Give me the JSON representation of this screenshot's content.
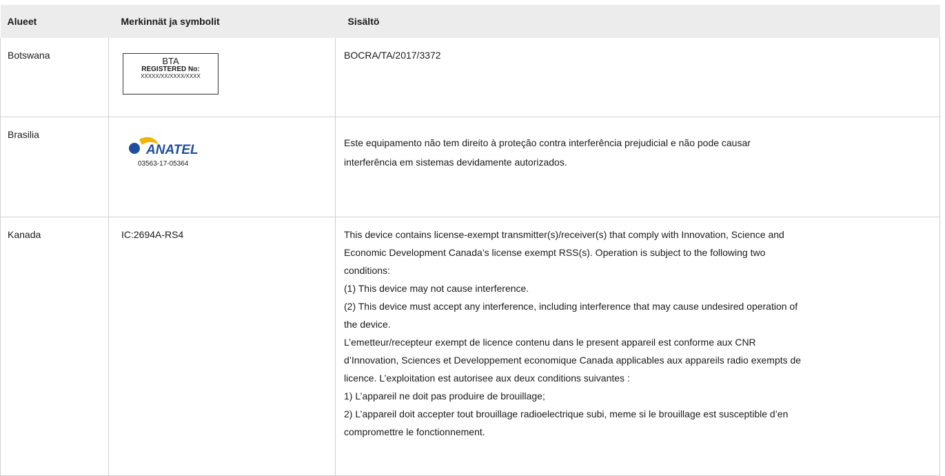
{
  "table": {
    "headers": [
      "Alueet",
      "Merkinnät ja symbolit",
      "Sisältö"
    ],
    "rows": [
      {
        "region": "Botswana",
        "mark": {
          "line1": "BTA",
          "line2": "REGISTERED No:",
          "line3": "XXXXX/XX/XXXX/XXXX"
        },
        "content_lines": [
          "BOCRA/TA/2017/3372"
        ]
      },
      {
        "region": "Brasilia",
        "mark": {
          "logo_text": "ANATEL",
          "code": "03563-17-05364"
        },
        "content_lines": [
          "Este equipamento não tem direito à proteção contra interferência prejudicial e não pode causar",
          "interferência em sistemas devidamente autorizados."
        ]
      },
      {
        "region": "Kanada",
        "mark": {
          "text": "IC:2694A-RS4"
        },
        "content_lines": [
          "This device contains license-exempt transmitter(s)/receiver(s) that comply with Innovation, Science and",
          "Economic Development Canada’s license exempt RSS(s). Operation is subject to the following two",
          "conditions:",
          "(1) This device may not cause interference.",
          "(2) This device must accept any interference, including interference that may cause undesired operation of",
          "the device.",
          "L’emetteur/recepteur exempt de licence contenu dans le present appareil est conforme aux CNR",
          "d’Innovation, Sciences et Developpement economique Canada applicables aux appareils radio exempts de",
          "licence. L’exploitation est autorisee aux deux conditions suivantes :",
          "1) L’appareil ne doit pas produire de brouillage;",
          "2) L’appareil doit accepter tout brouillage radioelectrique subi, meme si le brouillage est susceptible d’en",
          "compromettre le fonctionnement."
        ]
      }
    ]
  },
  "colors": {
    "header_bg": "#ececec",
    "border": "#d0d0d0",
    "anatel_blue": "#1f4e9c",
    "anatel_yellow": "#f2b300"
  }
}
